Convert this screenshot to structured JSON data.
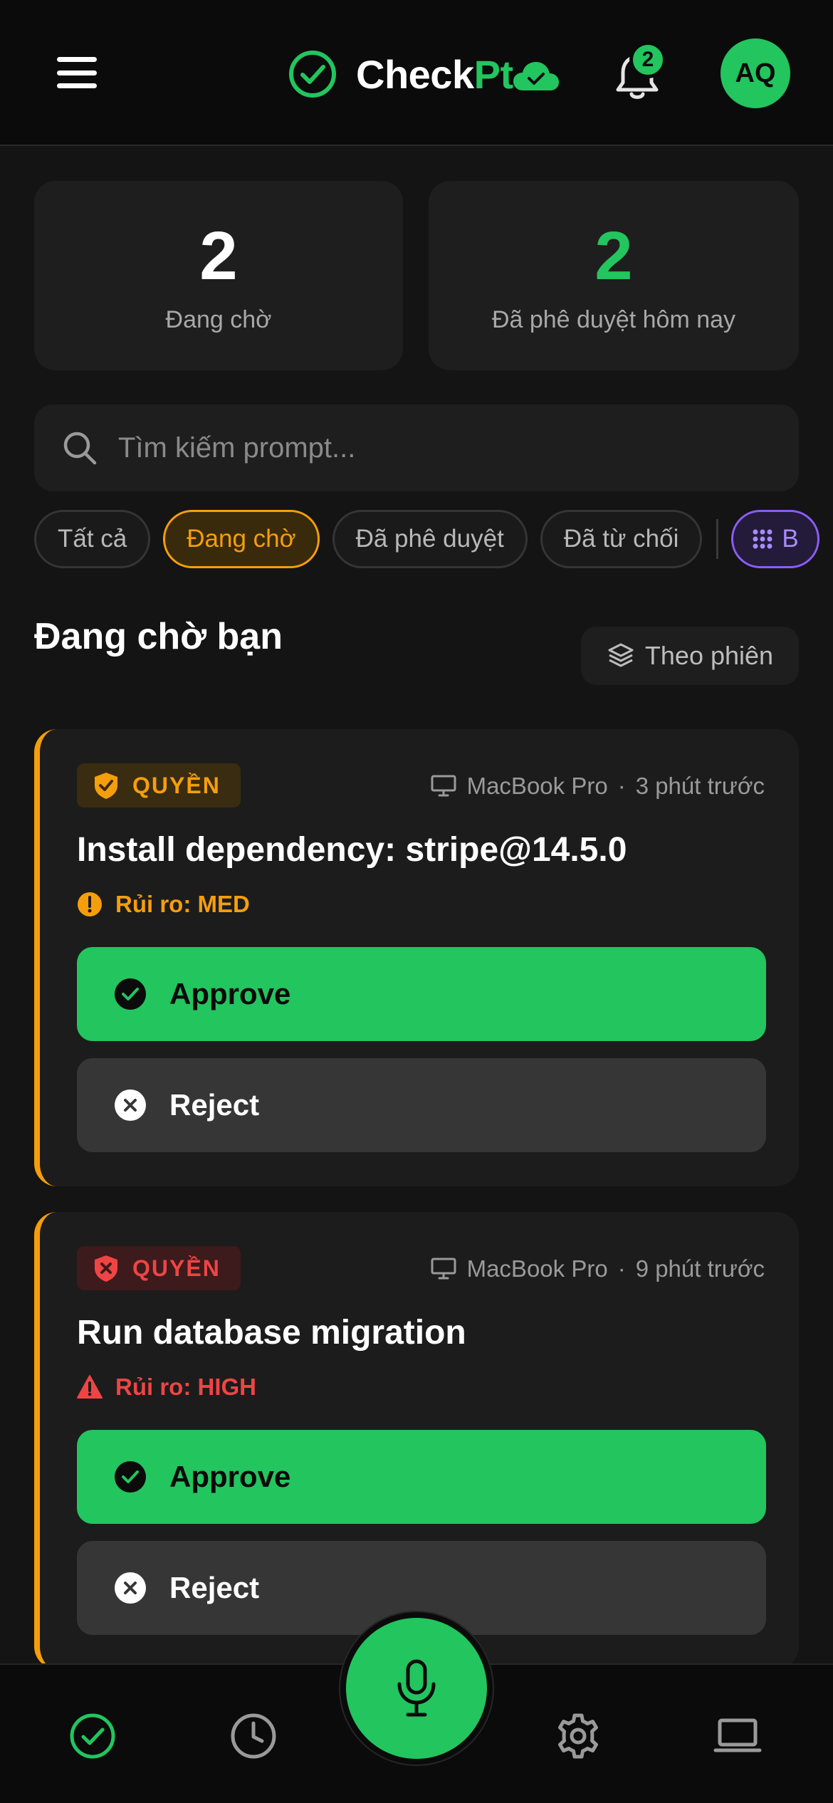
{
  "header": {
    "brand_prefix": "Check",
    "brand_accent": "Pt",
    "notification_count": "2",
    "avatar_initials": "AQ"
  },
  "stats": {
    "pending_value": "2",
    "pending_label": "Đang chờ",
    "approved_value": "2",
    "approved_label": "Đã phê duyệt hôm nay"
  },
  "search": {
    "placeholder": "Tìm kiếm prompt...",
    "value": ""
  },
  "filters": {
    "all": "Tất cả",
    "pending": "Đang chờ",
    "approved": "Đã phê duyệt",
    "rejected": "Đã từ chối",
    "extra": "B",
    "active": "pending"
  },
  "section": {
    "title": "Đang chờ bạn",
    "group_label": "Theo phiên"
  },
  "requests": [
    {
      "badge": "QUYỀN",
      "severity": "med",
      "device": "MacBook Pro",
      "separator": "·",
      "time": "3 phút trước",
      "title": "Install dependency: stripe@14.5.0",
      "risk": "Rủi ro: MED",
      "approve": "Approve",
      "reject": "Reject"
    },
    {
      "badge": "QUYỀN",
      "severity": "high",
      "device": "MacBook Pro",
      "separator": "·",
      "time": "9 phút trước",
      "title": "Run database migration",
      "risk": "Rủi ro: HIGH",
      "approve": "Approve",
      "reject": "Reject"
    }
  ],
  "nav": {
    "active": "home",
    "items": [
      "home-icon",
      "history-icon",
      "mic-icon",
      "settings-icon",
      "laptop-icon"
    ]
  },
  "colors": {
    "accent": "#22c55e",
    "warning": "#f59e0b",
    "danger": "#ef4444",
    "purple": "#8b5cf6",
    "background": "#141414"
  }
}
